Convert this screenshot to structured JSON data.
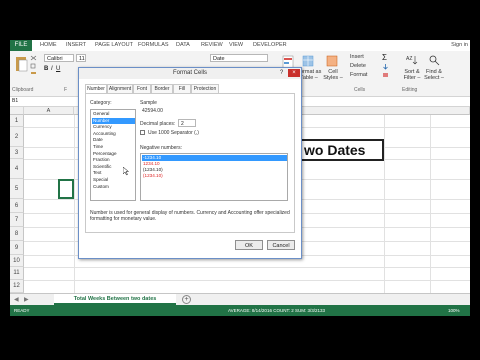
{
  "ribbon": {
    "tabs": [
      "FILE",
      "HOME",
      "INSERT",
      "PAGE LAYOUT",
      "FORMULAS",
      "DATA",
      "REVIEW",
      "VIEW",
      "DEVELOPER"
    ],
    "signin": "Sign in",
    "font_name": "Calibri",
    "font_size": "11",
    "number_format": "Date",
    "clipboard_label": "Clipboard",
    "font_label": "F",
    "format_as_table": "Format as Table –",
    "cell_styles": "Cell Styles –",
    "cells_label": "Cells",
    "insert": "Insert",
    "delete": "Delete",
    "format": "Format",
    "sort_filter": "Sort & Filter –",
    "find_select": "Find & Select –",
    "editing_label": "Editing",
    "accent_color": "#217346"
  },
  "formula_bar": {
    "name_box": "B1"
  },
  "grid": {
    "columns": [
      "A"
    ],
    "rows": [
      "1",
      "2",
      "3",
      "4",
      "5",
      "6",
      "7",
      "8",
      "9",
      "10",
      "11",
      "12"
    ],
    "title_cell_text": "wo Dates"
  },
  "sheet": {
    "tab_label": "Total Weeks Between two dates"
  },
  "status": {
    "ready": "READY",
    "summary": "AVERAGE: 8/14/2016   COUNT: 2   SUM: 3/3/2133",
    "zoom": "100%"
  },
  "dialog": {
    "title": "Format Cells",
    "tabs": [
      "Number",
      "Alignment",
      "Font",
      "Border",
      "Fill",
      "Protection"
    ],
    "category_label": "Category:",
    "categories": [
      "General",
      "Number",
      "Currency",
      "Accounting",
      "Date",
      "Time",
      "Percentage",
      "Fraction",
      "Scientific",
      "Text",
      "Special",
      "Custom"
    ],
    "selected_category": "Number",
    "sample_label": "Sample",
    "sample_value": "42594.00",
    "decimal_label": "Decimal places:",
    "decimal_value": "2",
    "separator_label": "Use 1000 Separator (,)",
    "negative_label": "Negative numbers:",
    "negative_numbers": [
      "-1234.10",
      "1234.10",
      "(1234.10)",
      "(1234.10)"
    ],
    "description": "Number is used for general display of numbers.  Currency and Accounting offer specialized formatting for monetary value.",
    "ok": "OK",
    "cancel": "Cancel"
  }
}
